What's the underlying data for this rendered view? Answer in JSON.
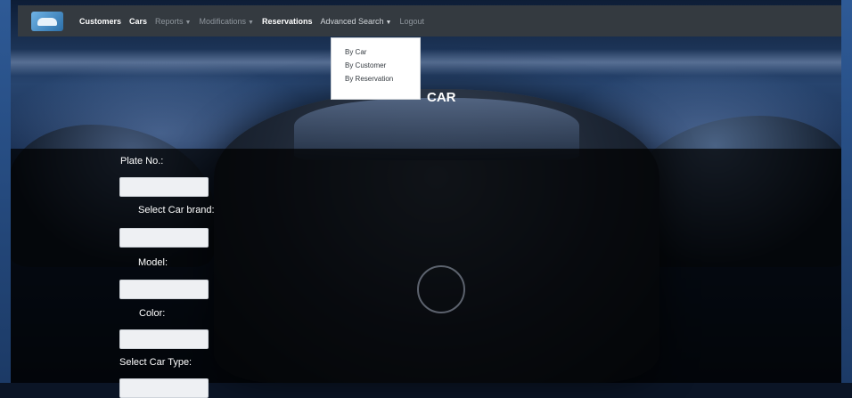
{
  "navbar": {
    "logo": "car-logo-icon",
    "items": [
      {
        "label": "Customers",
        "style": "active"
      },
      {
        "label": "Cars",
        "style": "active"
      },
      {
        "label": "Reports",
        "style": "muted",
        "dropdown": true
      },
      {
        "label": "Modifications",
        "style": "muted",
        "dropdown": true
      },
      {
        "label": "Reservations",
        "style": "active"
      },
      {
        "label": "Advanced Search",
        "style": "lite",
        "dropdown": true
      },
      {
        "label": "Logout",
        "style": "muted"
      }
    ]
  },
  "dropdown": {
    "items": [
      "By Car",
      "By Customer",
      "By Reservation"
    ]
  },
  "page": {
    "title": "CAR"
  },
  "form": {
    "plate_label": "Plate No.:",
    "brand_label": "Select Car brand:",
    "model_label": "Model:",
    "color_label": "Color:",
    "type_label": "Select Car Type:"
  },
  "colors": {
    "navbar_bg": "#343a40",
    "panel_bg": "rgba(0,0,0,0.72)",
    "field_bg": "#eef0f3"
  }
}
